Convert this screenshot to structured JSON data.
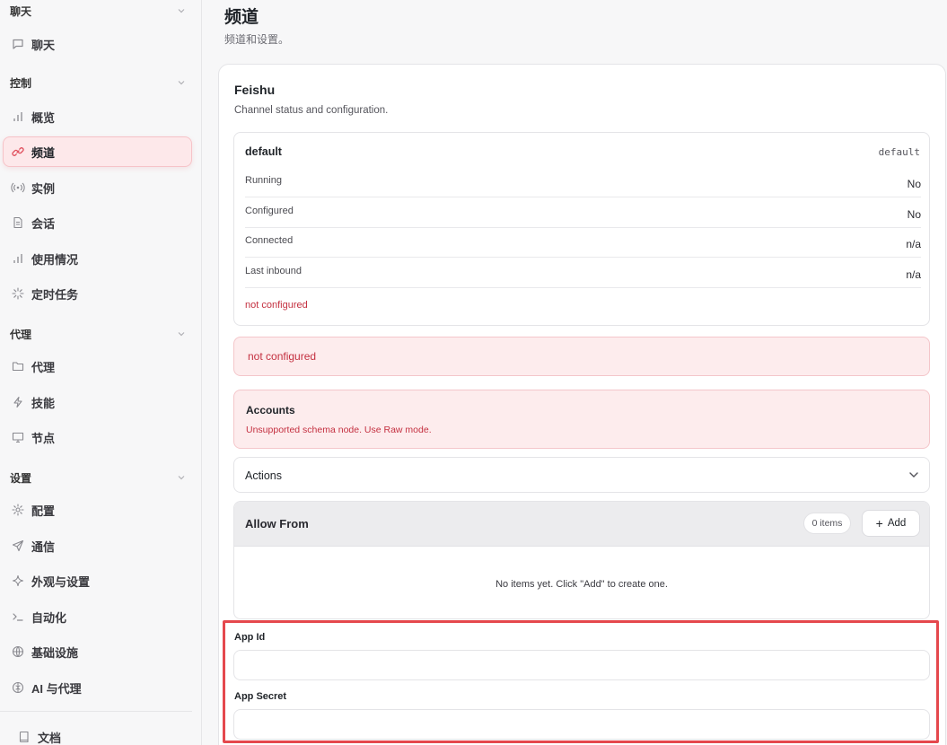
{
  "sidebar": {
    "groups": [
      {
        "label": "聊天"
      },
      {
        "label": "控制"
      },
      {
        "label": "代理"
      },
      {
        "label": "设置"
      }
    ],
    "items": [
      {
        "label": "聊天",
        "icon": "chat-bubble-icon"
      },
      {
        "label": "概览",
        "icon": "bar-chart-icon"
      },
      {
        "label": "频道",
        "icon": "link-icon",
        "active": true
      },
      {
        "label": "实例",
        "icon": "broadcast-icon"
      },
      {
        "label": "会话",
        "icon": "document-icon"
      },
      {
        "label": "使用情况",
        "icon": "bar-chart-icon"
      },
      {
        "label": "定时任务",
        "icon": "loader-icon"
      },
      {
        "label": "代理",
        "icon": "folder-icon"
      },
      {
        "label": "技能",
        "icon": "lightning-icon"
      },
      {
        "label": "节点",
        "icon": "monitor-icon"
      },
      {
        "label": "配置",
        "icon": "gear-icon"
      },
      {
        "label": "通信",
        "icon": "send-icon"
      },
      {
        "label": "外观与设置",
        "icon": "sparkle-icon"
      },
      {
        "label": "自动化",
        "icon": "terminal-icon"
      },
      {
        "label": "基础设施",
        "icon": "globe-icon"
      },
      {
        "label": "AI 与代理",
        "icon": "brain-icon"
      },
      {
        "label": "文档",
        "icon": "book-icon"
      }
    ]
  },
  "header": {
    "title": "频道",
    "subtitle": "频道和设置。"
  },
  "channel": {
    "name": "Feishu",
    "description": "Channel status and configuration.",
    "account": {
      "name": "default",
      "code": "default",
      "rows": [
        {
          "key": "Running",
          "value": "No"
        },
        {
          "key": "Configured",
          "value": "No"
        },
        {
          "key": "Connected",
          "value": "n/a"
        },
        {
          "key": "Last inbound",
          "value": "n/a"
        }
      ],
      "error": "not configured"
    },
    "alert": "not configured",
    "accounts": {
      "title": "Accounts",
      "message": "Unsupported schema node. Use Raw mode."
    },
    "actions": {
      "label": "Actions"
    },
    "allow_from": {
      "title": "Allow From",
      "count": "0 items",
      "add_label": "Add",
      "empty": "No items yet. Click \"Add\" to create one."
    },
    "fields": [
      {
        "label": "App Id",
        "value": ""
      },
      {
        "label": "App Secret",
        "value": ""
      }
    ]
  },
  "colors": {
    "accent": "#e0505e",
    "error_text": "#c43040",
    "error_bg": "#fdeced",
    "highlight": "#e5484d"
  }
}
